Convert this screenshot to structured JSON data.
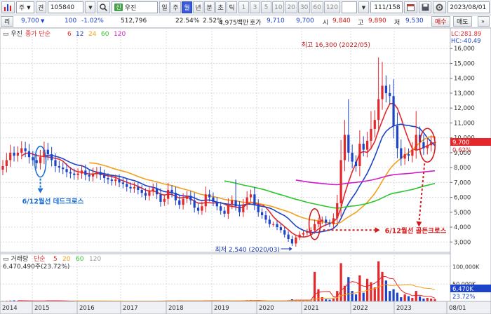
{
  "toolbar": {
    "menu_icon": "chart-menu-icon",
    "market_type": "주",
    "period_tab": "견",
    "code": "105840",
    "search_icon": "search-icon",
    "sin_label": "신",
    "stock_name": "우진",
    "periods": [
      "일",
      "주",
      "월",
      "년",
      "분",
      "초",
      "틱"
    ],
    "selected_period": "월",
    "minutes": [
      "1",
      "3",
      "5",
      "10",
      "20",
      "30",
      "60",
      "120"
    ],
    "record_count": "111",
    "record_total": "/158",
    "end_date": "2023/08/01"
  },
  "quote": {
    "price": "9,700",
    "change": "100",
    "change_pct": "-1.02%",
    "volume": "512,796",
    "turnover_pct": "22.54%",
    "ratio": "2.52%",
    "trade_value": "4,975백만",
    "bid_label": "호가",
    "bid": "9,710",
    "ask": "9,700",
    "open_label": "시",
    "open": "9,840",
    "high_label": "고",
    "high": "9,890",
    "low_label": "저",
    "low": "9,530",
    "buy_label": "매수",
    "sell_label": "매도",
    "list_label": "리"
  },
  "chart_data": [
    {
      "type": "candlestick",
      "legend": {
        "stock": "우진",
        "ma_title": "종가 단순",
        "ma_periods": [
          "6",
          "12",
          "24",
          "60",
          "120"
        ],
        "lc_label": "LC:281.89",
        "hc_label": "HC:-40.49"
      },
      "ylim": [
        2400,
        17000
      ],
      "y_ticks": [
        3000,
        4000,
        5000,
        6000,
        7000,
        8000,
        9000,
        10000,
        11000,
        12000,
        13000,
        14000,
        15000,
        16000
      ],
      "y_tick_labels": [
        "3,000",
        "4,000",
        "5,000",
        "6,000",
        "7,000",
        "8,000",
        "9,000",
        "10,000",
        "11,000",
        "12,000",
        "13,000",
        "14,000",
        "15,000",
        "16,000"
      ],
      "current_price": "9,700",
      "current_price_value": 9700,
      "current_pct": "0.62%",
      "annotations": {
        "high": "최고 16,300 (2022/05)",
        "low": "최저 2,540 (2020/03)",
        "dead_cross": "6/12월선 데드크로스",
        "golden_cross": "6/12월선 골든크로스"
      },
      "x_labels": [
        "2014",
        "2015",
        "2016",
        "2017",
        "2018",
        "2019",
        "2020",
        "2021",
        "2022",
        "2023",
        "08/01"
      ],
      "candle_count": 116,
      "close": [
        8100,
        8500,
        9000,
        8800,
        9000,
        9300,
        9100,
        8700,
        8500,
        8300,
        8700,
        9200,
        8900,
        8500,
        8100,
        8000,
        7900,
        7700,
        7600,
        7500,
        7600,
        7800,
        7500,
        7400,
        7600,
        7700,
        7500,
        7300,
        7200,
        7100,
        7200,
        7000,
        6900,
        6700,
        6600,
        6700,
        6500,
        6300,
        6100,
        6400,
        6600,
        6200,
        5700,
        5900,
        6500,
        6300,
        5800,
        5500,
        5900,
        6100,
        5800,
        5300,
        5100,
        5400,
        6200,
        6000,
        5700,
        5400,
        5100,
        4900,
        5500,
        5800,
        5400,
        5000,
        5500,
        6000,
        6200,
        5500,
        5000,
        4800,
        4500,
        4200,
        4200,
        4000,
        3800,
        3500,
        3200,
        2900,
        3300,
        3500,
        3600,
        3700,
        3800,
        4200,
        4400,
        4500,
        4300,
        4200,
        4600,
        5600,
        8500,
        10200,
        9000,
        8400,
        8100,
        9600,
        9200,
        9800,
        10600,
        11200,
        12600,
        13500,
        13000,
        12800,
        10800,
        9300,
        8600,
        8900,
        8800,
        9200,
        10200,
        9700,
        9300,
        9500,
        9700,
        9700
      ]
    },
    {
      "type": "bar",
      "legend": {
        "title": "거래량",
        "ma_title": "단순",
        "ma_periods": [
          "5",
          "20",
          "60",
          "120"
        ],
        "current": "6,470,490주(23.72%)"
      },
      "ylim": [
        0,
        125000
      ],
      "y_ticks": [
        50000,
        100000
      ],
      "y_tick_labels": [
        "50,000K",
        "100,000K"
      ],
      "current_volume_label": "6,470K",
      "current_pct": "23.72%",
      "values": [
        1500,
        1800,
        2500,
        3000,
        2000,
        1500,
        1200,
        1000,
        1500,
        1800,
        1200,
        2000,
        3000,
        2500,
        1500,
        1200,
        1000,
        800,
        900,
        1000,
        1200,
        900,
        800,
        1000,
        1100,
        1200,
        900,
        800,
        700,
        900,
        1000,
        800,
        700,
        600,
        700,
        800,
        900,
        700,
        600,
        900,
        1200,
        1000,
        1400,
        1600,
        2200,
        1800,
        1500,
        1800,
        1200,
        1000,
        1500,
        2000,
        1500,
        1200,
        3000,
        2500,
        1800,
        1500,
        1200,
        1000,
        2500,
        2000,
        1500,
        1200,
        2800,
        3500,
        4000,
        2500,
        2000,
        1500,
        1200,
        1000,
        1200,
        1500,
        1800,
        2500,
        3500,
        6000,
        4500,
        2500,
        3000,
        3500,
        4500,
        85000,
        35000,
        12000,
        6000,
        5000,
        8000,
        30000,
        110000,
        45000,
        70000,
        30000,
        20000,
        75000,
        25000,
        65000,
        55000,
        40000,
        115000,
        85000,
        60000,
        30000,
        35000,
        25000,
        12000,
        20000,
        15000,
        10000,
        30000,
        14000,
        8000,
        10000,
        8000,
        6470
      ]
    }
  ],
  "colors": {
    "up": "#e3272b",
    "down": "#1d43c8",
    "ma6": "#e3272b",
    "ma12": "#1d43c8",
    "ma24": "#f3a01a",
    "ma60": "#2fc52f",
    "ma120": "#d21cc8",
    "annotation": "#1d6fd4"
  }
}
